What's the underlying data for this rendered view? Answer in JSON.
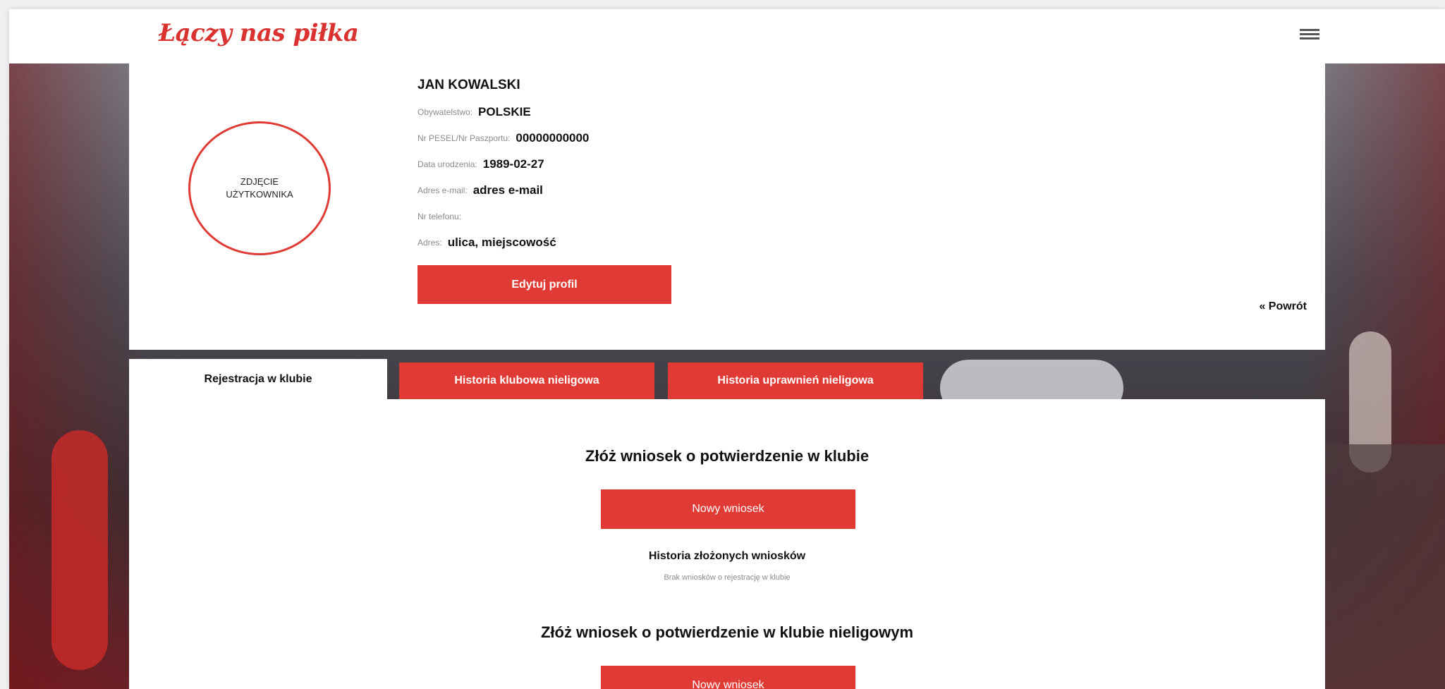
{
  "header": {
    "logo_text": "Łączy nas piłka",
    "menu_icon": "hamburger-icon"
  },
  "profile": {
    "photo_placeholder": "ZDJĘCIE UŻYTKOWNIKA",
    "name": "JAN KOWALSKI",
    "fields": [
      {
        "label": "Obywatelstwo:",
        "value": "POLSKIE"
      },
      {
        "label": "Nr PESEL/Nr Paszportu:",
        "value": "00000000000"
      },
      {
        "label": "Data urodzenia:",
        "value": "1989-02-27"
      },
      {
        "label": "Adres e-mail:",
        "value": "adres e-mail"
      },
      {
        "label": "Nr telefonu:",
        "value": ""
      },
      {
        "label": "Adres:",
        "value": "ulica, miejscowość"
      }
    ],
    "edit_button": "Edytuj profil",
    "back_link": "« Powrót"
  },
  "tabs": [
    {
      "label": "Rejestracja w klubie",
      "active": true
    },
    {
      "label": "Historia klubowa nieligowa",
      "active": false
    },
    {
      "label": "Historia uprawnień nieligowa",
      "active": false
    }
  ],
  "content": {
    "section1_heading": "Złóż wniosek o potwierdzenie w klubie",
    "section1_button": "Nowy wniosek",
    "history_title": "Historia złożonych wniosków",
    "history_empty": "Brak wniosków o rejestrację w klubie",
    "section2_heading": "Złóż wniosek o potwierdzenie w klubie nieligowym",
    "section2_button": "Nowy wniosek"
  },
  "colors": {
    "accent": "#e03a35",
    "logo": "#d9322f"
  }
}
